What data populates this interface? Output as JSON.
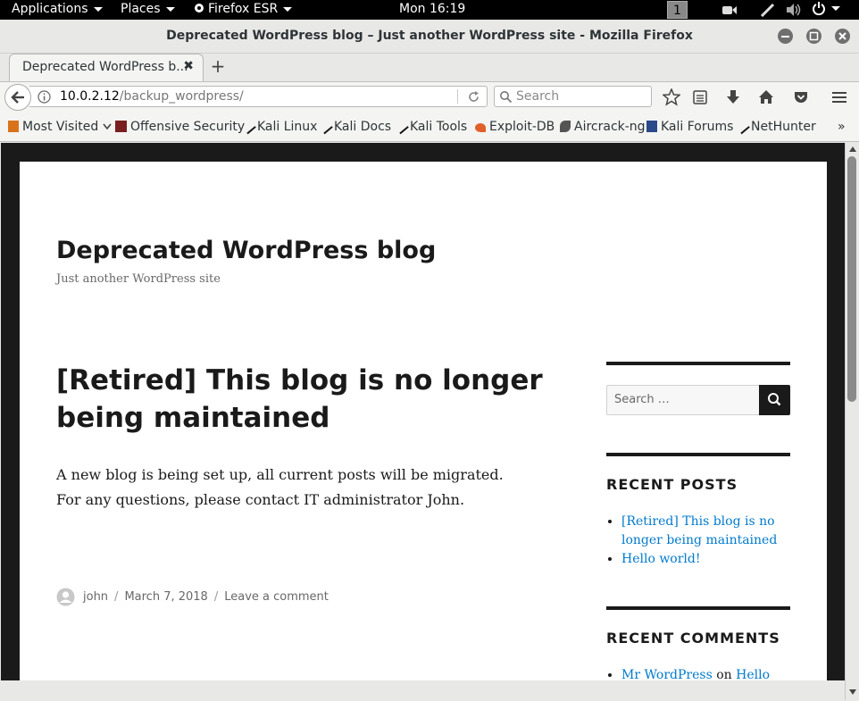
{
  "system_bar": {
    "applications": "Applications",
    "places": "Places",
    "firefox": "Firefox ESR",
    "clock": "Mon 16:19",
    "workspace": "1"
  },
  "window": {
    "title": "Deprecated WordPress blog – Just another WordPress site - Mozilla Firefox"
  },
  "tab": {
    "label": "Deprecated WordPress b..."
  },
  "navbar": {
    "url_host": "10.0.2.12",
    "url_path": "/backup_wordpress/",
    "search_placeholder": "Search"
  },
  "bookmarks": [
    {
      "label": "Most Visited",
      "color": "#d9731a"
    },
    {
      "label": "Offensive Security",
      "color": "#7a1f1f"
    },
    {
      "label": "Kali Linux",
      "color": "#1a1a1a"
    },
    {
      "label": "Kali Docs",
      "color": "#1a1a1a"
    },
    {
      "label": "Kali Tools",
      "color": "#1a1a1a"
    },
    {
      "label": "Exploit-DB",
      "color": "#e0602a"
    },
    {
      "label": "Aircrack-ng",
      "color": "#555555"
    },
    {
      "label": "Kali Forums",
      "color": "#2a4a8a"
    },
    {
      "label": "NetHunter",
      "color": "#1a1a1a"
    }
  ],
  "site": {
    "title": "Deprecated WordPress blog",
    "description": "Just another WordPress site"
  },
  "post": {
    "title": "[Retired] This blog is no longer being maintained",
    "body_line1": "A new blog is being set up, all current posts will be migrated.",
    "body_line2": "For any questions, please contact IT administrator John.",
    "author": "john",
    "date": "March 7, 2018",
    "comment_link": "Leave a comment"
  },
  "sidebar": {
    "search_placeholder": "Search …",
    "recent_posts_title": "RECENT POSTS",
    "recent_posts": [
      "[Retired] This blog is no longer being maintained",
      "Hello world!"
    ],
    "recent_comments_title": "RECENT COMMENTS",
    "recent_comment_author": "Mr WordPress",
    "recent_comment_on": "on",
    "recent_comment_post": "Hello"
  },
  "colors": {
    "link": "#007acc",
    "page_frame": "#1a1a1a"
  }
}
